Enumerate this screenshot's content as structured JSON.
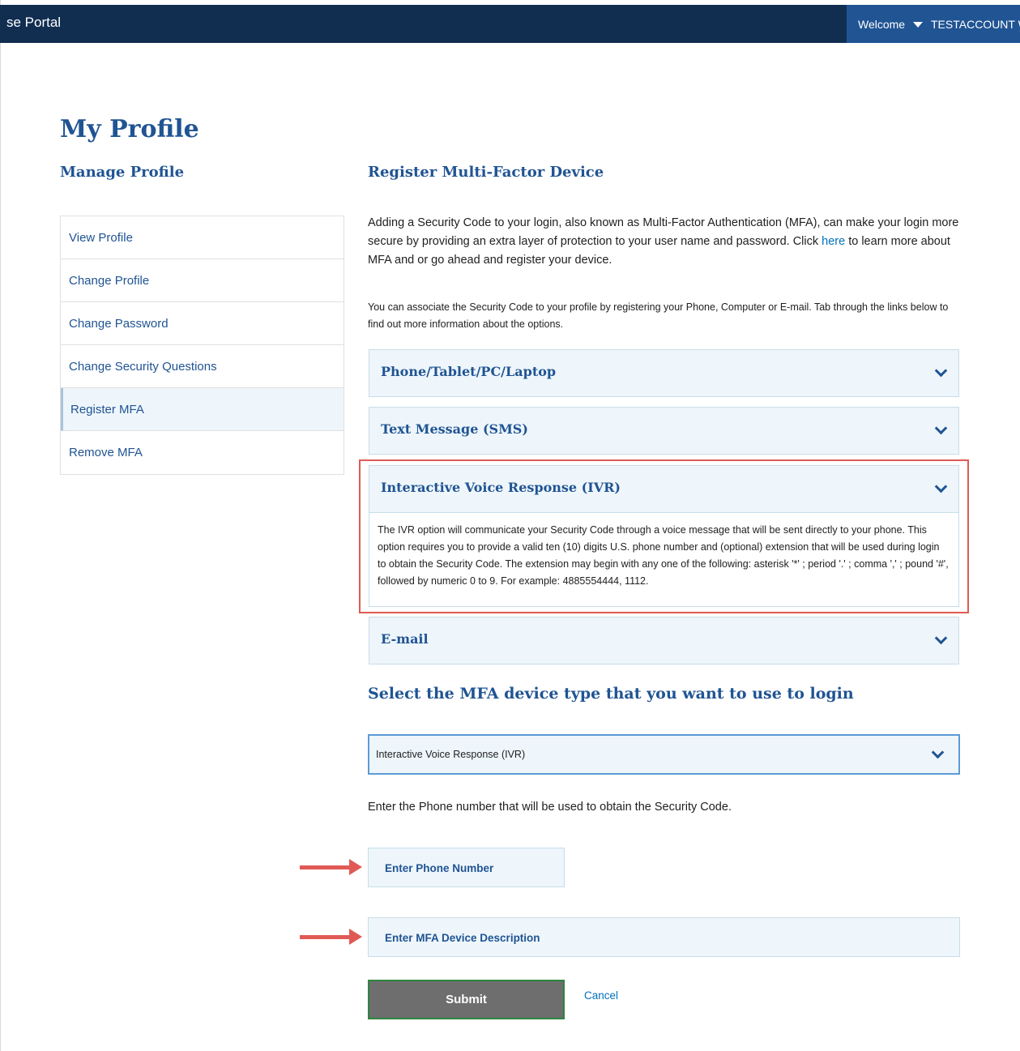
{
  "header": {
    "portal_title": "se Portal",
    "welcome": "Welcome",
    "account_name": "TESTACCOUNT W"
  },
  "page": {
    "title": "My Profile"
  },
  "sidebar": {
    "title": "Manage Profile",
    "items": [
      {
        "label": "View Profile",
        "active": false
      },
      {
        "label": "Change Profile",
        "active": false
      },
      {
        "label": "Change Password",
        "active": false
      },
      {
        "label": "Change Security Questions",
        "active": false
      },
      {
        "label": "Register MFA",
        "active": true
      },
      {
        "label": "Remove MFA",
        "active": false
      }
    ]
  },
  "main": {
    "title": "Register Multi-Factor Device",
    "intro_text": "Adding a Security Code to your login, also known as Multi-Factor Authentication (MFA), can make your login more secure by providing an extra layer of protection to your user name and password. Click",
    "intro_link": "here",
    "intro_text_end": "to learn more about MFA and or go ahead and register your device.",
    "associate_text": "You can associate the Security Code to your profile by registering your Phone, Computer or E-mail. Tab through the links below to find out more information about the options.",
    "accordion": [
      {
        "title": "Phone/Tablet/PC/Laptop",
        "expanded": false
      },
      {
        "title": "Text Message (SMS)",
        "expanded": false
      },
      {
        "title": "Interactive Voice Response (IVR)",
        "expanded": true,
        "body": "The IVR option will communicate your Security Code through a voice message that will be sent directly to your phone. This option requires you to provide a valid ten (10) digits U.S. phone number and (optional) extension that will be used during login to obtain the Security Code. The extension may begin with any one of the following: asterisk '*' ; period '.' ; comma ',' ; pound '#', followed by numeric 0 to 9. For example: 4885554444, 1112."
      },
      {
        "title": "E-mail",
        "expanded": false
      }
    ],
    "select_heading": "Select the MFA device type that you want to use to login",
    "device_type_selected": "Interactive Voice Response (IVR)",
    "phone_hint": "Enter the Phone number that will be used to obtain the Security Code.",
    "phone_placeholder": "Enter Phone Number",
    "description_placeholder": "Enter MFA Device Description",
    "submit_label": "Submit",
    "cancel_label": "Cancel"
  },
  "colors": {
    "header_bg": "#112e51",
    "welcome_bg": "#205493",
    "heading": "#205493",
    "link": "#0071bc",
    "annotation": "#e05a55",
    "submit_bg": "#6e6e6e",
    "submit_border": "#2e8540"
  }
}
